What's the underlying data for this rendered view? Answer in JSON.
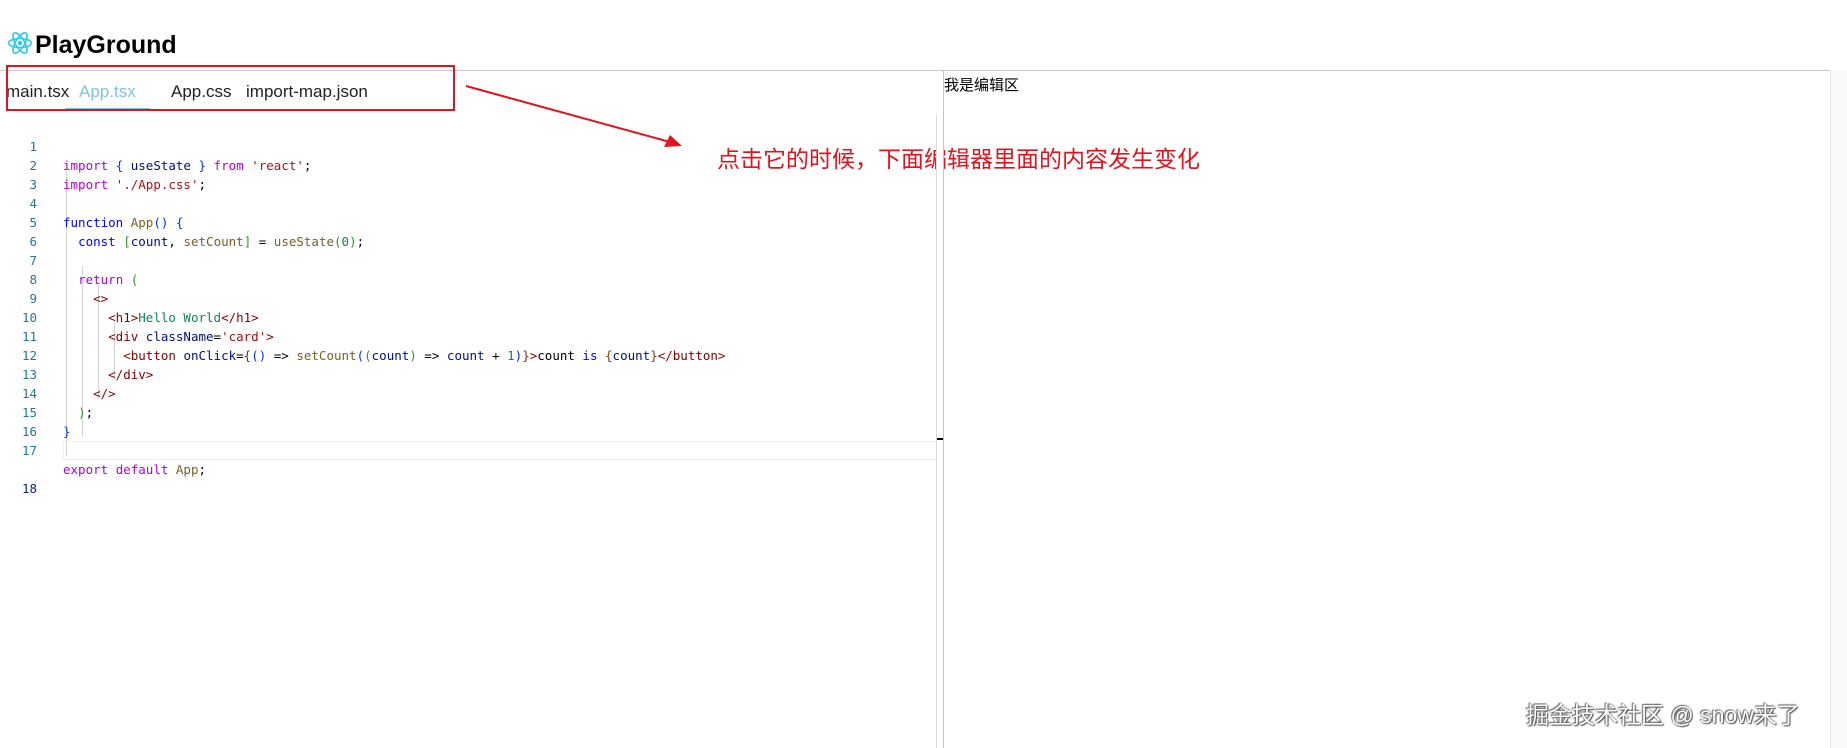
{
  "header": {
    "title": "PlayGround",
    "logo_icon": "react-atom-icon",
    "logo_color": "#2ec8e6"
  },
  "tabs": [
    {
      "label": "main.tsx",
      "active": false
    },
    {
      "label": "App.tsx",
      "active": true
    },
    {
      "label": "App.css",
      "active": false
    },
    {
      "label": "import-map.json",
      "active": false
    }
  ],
  "annotation": {
    "text": "点击它的时候，下面编辑器里面的内容发生变化",
    "color": "#e0141e"
  },
  "editor": {
    "current_line": 18,
    "line_numbers": [
      "1",
      "2",
      "3",
      "4",
      "5",
      "6",
      "7",
      "8",
      "9",
      "10",
      "11",
      "12",
      "13",
      "14",
      "15",
      "16",
      "17",
      "18"
    ],
    "lines": [
      "import { useState } from 'react';",
      "import './App.css';",
      "",
      "function App() {",
      "  const [count, setCount] = useState(0);",
      "",
      "  return (",
      "    <>",
      "      <h1>Hello World</h1>",
      "      <div className='card'>",
      "        <button onClick={() => setCount((count) => count + 1)}>count is {count}</button>",
      "      </div>",
      "    </>",
      "  );",
      "}",
      "",
      "export default App;",
      ""
    ]
  },
  "preview": {
    "title": "我是编辑区"
  },
  "watermark": {
    "text": "掘金技术社区 @ snow来了"
  },
  "colors": {
    "active_tab": "#7ec2e2",
    "keyword": "#0000ff",
    "string": "#a31515",
    "line_number": "#237893"
  }
}
